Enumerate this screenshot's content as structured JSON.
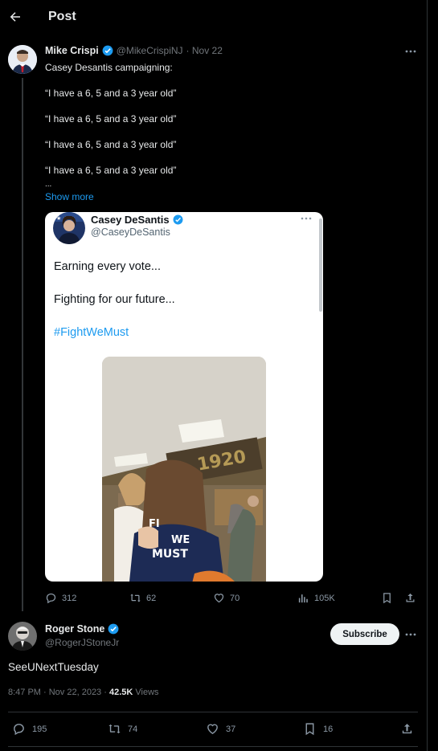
{
  "header": {
    "title": "Post"
  },
  "main_tweet": {
    "author_name": "Mike Crispi",
    "author_handle": "@MikeCrispiNJ",
    "date": "· Nov 22",
    "text_lines": [
      "Casey Desantis campaigning:",
      "“I have a 6, 5 and a 3 year old”",
      "“I have a 6, 5 and a 3 year old”",
      "“I have a 6, 5 and a 3 year old”",
      "“I have a 6, 5 and a 3 year old”",
      "..."
    ],
    "show_more": "Show more",
    "quoted": {
      "author_name": "Casey DeSantis",
      "author_handle": "@CaseyDeSantis",
      "line1": "Earning every vote...",
      "line2": "Fighting for our future...",
      "hashtag": "#FightWeMust",
      "video_sign": "1920",
      "shirt_text_1": "FI",
      "shirt_text_2": "WE",
      "shirt_text_3": "MUST"
    },
    "actions": {
      "replies": "312",
      "reposts": "62",
      "likes": "70",
      "views": "105K"
    }
  },
  "reply": {
    "author_name": "Roger Stone",
    "author_handle": "@RogerJStoneJr",
    "subscribe_label": "Subscribe",
    "text": "SeeUNextTuesday",
    "timestamp": "8:47 PM · Nov 22, 2023 · ",
    "views_count": "42.5K",
    "views_label": " Views",
    "actions": {
      "replies": "195",
      "reposts": "74",
      "likes": "37",
      "bookmarks": "16"
    }
  },
  "colors": {
    "accent": "#1d9bf0",
    "background": "#000000",
    "muted": "#71767b"
  }
}
